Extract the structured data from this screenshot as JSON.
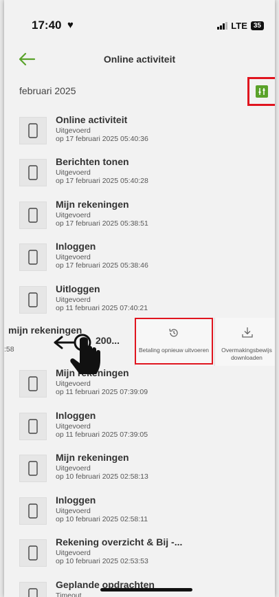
{
  "status_bar": {
    "time": "17:40",
    "network": "LTE",
    "battery": "35"
  },
  "header": {
    "title": "Online activiteit"
  },
  "filter": {
    "month": "februari 2025"
  },
  "activities": [
    {
      "name": "Online activiteit",
      "status": "Uitgevoerd",
      "date": "op 17 februari 2025 05:40:36"
    },
    {
      "name": "Berichten tonen",
      "status": "Uitgevoerd",
      "date": "op 17 februari 2025 05:40:28"
    },
    {
      "name": "Mijn rekeningen",
      "status": "Uitgevoerd",
      "date": "op 17 februari 2025 05:38:51"
    },
    {
      "name": "Inloggen",
      "status": "Uitgevoerd",
      "date": "op 17 februari 2025 05:38:46"
    },
    {
      "name": "Uitloggen",
      "status": "Uitgevoerd",
      "date": "op 11 februari 2025 07:40:21"
    },
    {
      "name": "Mijn rekeningen",
      "status": "Uitgevoerd",
      "date": "op 11 februari 2025 07:39:09"
    },
    {
      "name": "Inloggen",
      "status": "Uitgevoerd",
      "date": "op 11 februari 2025 07:39:05"
    },
    {
      "name": "Mijn rekeningen",
      "status": "Uitgevoerd",
      "date": "op 10 februari 2025 02:58:13"
    },
    {
      "name": "Inloggen",
      "status": "Uitgevoerd",
      "date": "op 10 februari 2025 02:58:11"
    },
    {
      "name": "Rekening overzicht & Bij -...",
      "status": "Uitgevoerd",
      "date": "op 10 februari 2025 02:53:53"
    },
    {
      "name": "Geplande opdrachten",
      "status": "Timeout",
      "date": ""
    }
  ],
  "swiped_row": {
    "name": "mijn rekeningen",
    "time": ":58",
    "amount": "200...",
    "actions": [
      {
        "label": "Betaling opnieuw uitvoeren",
        "icon": "history-icon"
      },
      {
        "label": "Overmakingsbewijs downloaden",
        "icon": "download-icon"
      }
    ]
  },
  "colors": {
    "accent": "#5aa22a",
    "highlight": "#e0141e"
  }
}
